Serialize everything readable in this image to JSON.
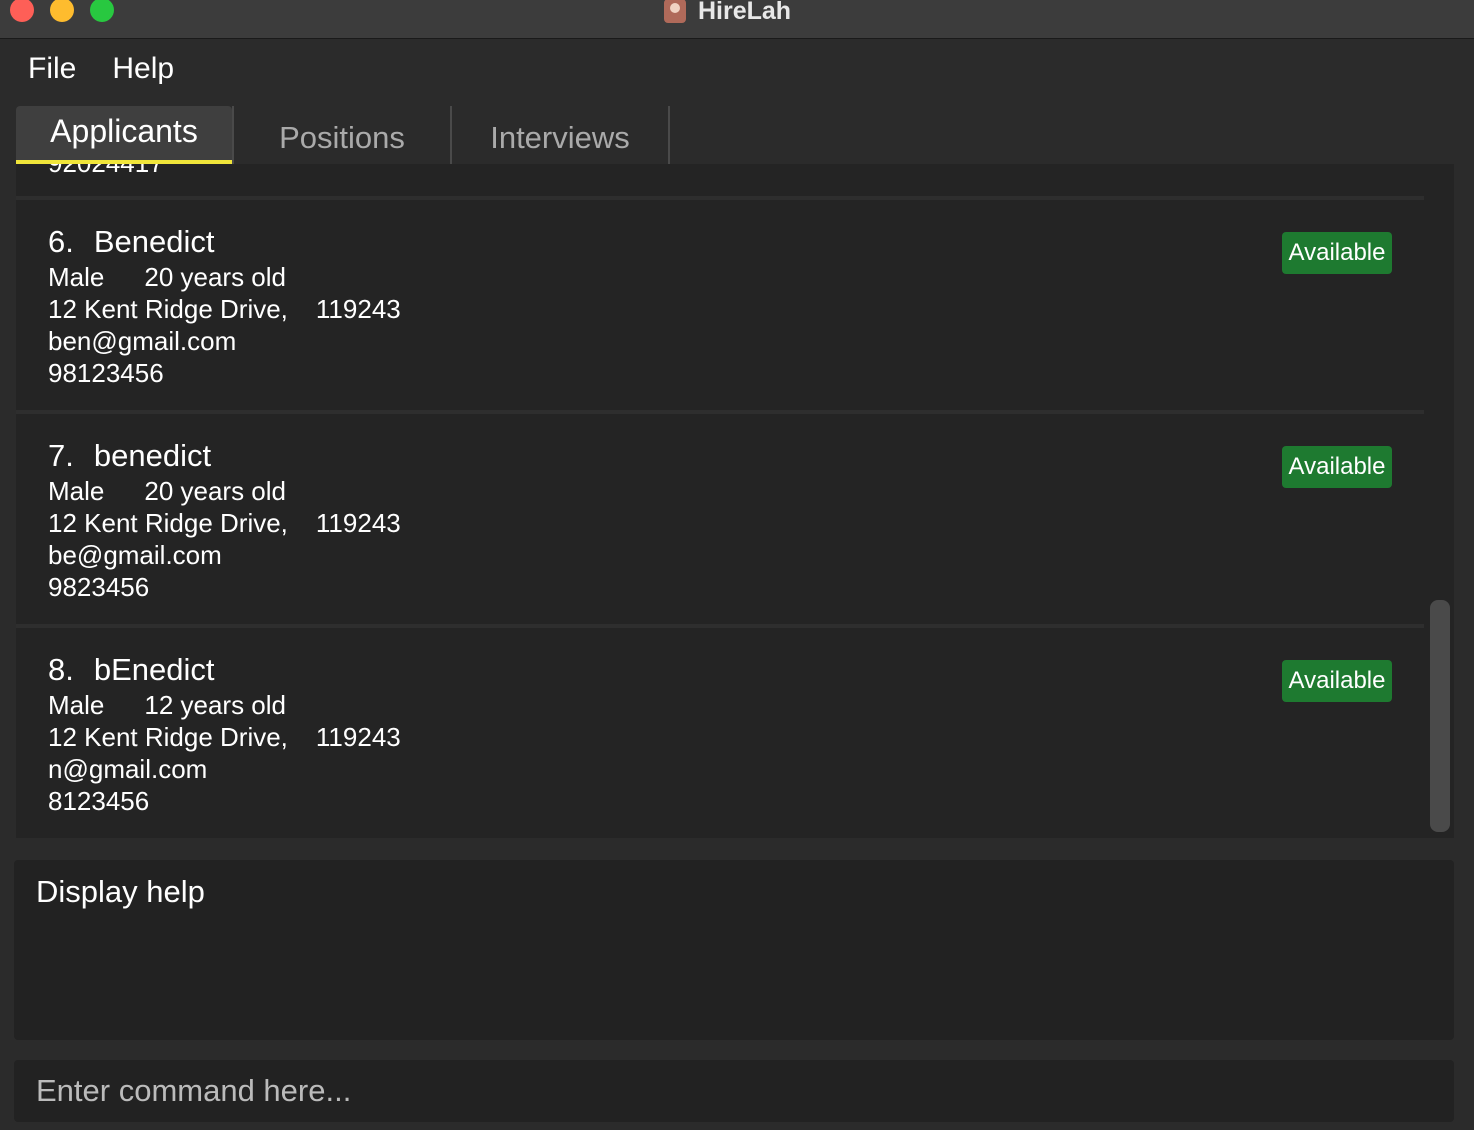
{
  "window": {
    "title": "HireLah"
  },
  "menu": {
    "file": "File",
    "help": "Help"
  },
  "tabs": {
    "applicants": "Applicants",
    "positions": "Positions",
    "interviews": "Interviews"
  },
  "partial_row_text": "92024417",
  "applicants": [
    {
      "index": "6.",
      "name": "Benedict",
      "gender": "Male",
      "age": "20 years old",
      "address": "12 Kent Ridge Drive,",
      "postal": "119243",
      "email": "ben@gmail.com",
      "phone": "98123456",
      "status": "Available"
    },
    {
      "index": "7.",
      "name": "benedict",
      "gender": "Male",
      "age": "20 years old",
      "address": "12 Kent Ridge Drive,",
      "postal": "119243",
      "email": "be@gmail.com",
      "phone": "9823456",
      "status": "Available"
    },
    {
      "index": "8.",
      "name": "bEnedict",
      "gender": "Male",
      "age": "12 years old",
      "address": "12 Kent Ridge Drive,",
      "postal": "119243",
      "email": "n@gmail.com",
      "phone": "8123456",
      "status": "Available"
    }
  ],
  "result_display": {
    "text": "Display help"
  },
  "command_box": {
    "placeholder": "Enter command here...",
    "value": ""
  },
  "colors": {
    "accent_tab_underline": "#f0e53a",
    "status_available": "#1e7a30",
    "background": "#2b2b2b",
    "panel": "#242424"
  }
}
